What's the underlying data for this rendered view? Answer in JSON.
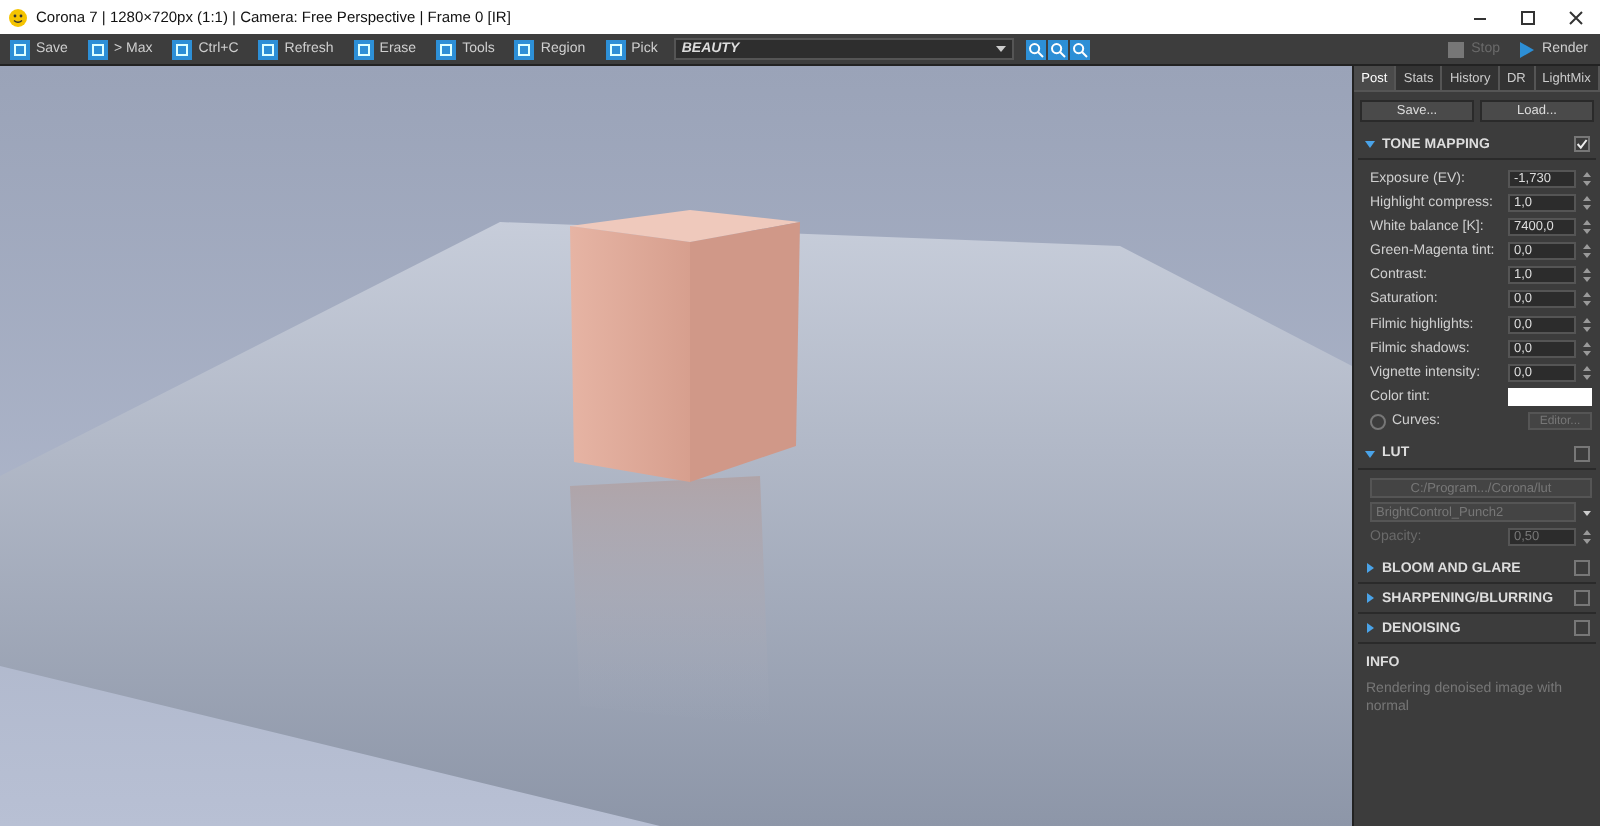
{
  "window": {
    "title": "Corona 7 | 1280×720px (1:1) | Camera: Free Perspective | Frame 0 [IR]"
  },
  "toolbar": {
    "buttons": [
      "Save",
      "> Max",
      "Ctrl+C",
      "Refresh",
      "Erase",
      "Tools",
      "Region",
      "Pick"
    ],
    "pass": "BEAUTY",
    "stop": {
      "label": "Stop",
      "disabled": true
    },
    "render": {
      "label": "Render",
      "disabled": false
    }
  },
  "panel": {
    "tabs": [
      {
        "label": "Post",
        "selected": true
      },
      {
        "label": "Stats",
        "selected": false
      },
      {
        "label": "History",
        "selected": false
      },
      {
        "label": "DR",
        "selected": false
      },
      {
        "label": "LightMix",
        "selected": false
      }
    ],
    "buttons": [
      "Save...",
      "Load..."
    ],
    "sections": [
      {
        "title": "TONE MAPPING",
        "expanded": true,
        "checked": true,
        "rows": [
          {
            "kind": "spinner",
            "label": "Exposure (EV):",
            "value": "-1,730",
            "disabled": false
          },
          {
            "kind": "spinner",
            "label": "Highlight compress:",
            "value": "1,0",
            "disabled": false
          },
          {
            "kind": "spinner",
            "label": "White balance [K]:",
            "value": "7400,0",
            "disabled": false
          },
          {
            "kind": "spinner",
            "label": "Green-Magenta tint:",
            "value": "0,0",
            "disabled": false
          },
          {
            "kind": "spinner",
            "label": "Contrast:",
            "value": "1,0",
            "disabled": false
          },
          {
            "kind": "spinner",
            "label": "Saturation:",
            "value": "0,0",
            "disabled": false
          },
          {
            "kind": "spinner",
            "label": "Filmic highlights:",
            "value": "0,0",
            "disabled": false
          },
          {
            "kind": "spinner",
            "label": "Filmic shadows:",
            "value": "0,0",
            "disabled": false
          },
          {
            "kind": "spinner",
            "label": "Vignette intensity:",
            "value": "0,0",
            "disabled": false
          },
          {
            "kind": "color",
            "label": "Color tint:",
            "color": "#ffffff"
          },
          {
            "kind": "check",
            "label": "Curves:",
            "checked": false,
            "button": "Editor...",
            "disabled": true
          }
        ]
      },
      {
        "title": "LUT",
        "expanded": true,
        "checked": false,
        "rows": [
          {
            "kind": "path",
            "value": "C:/Program.../Corona/lut",
            "disabled": true
          },
          {
            "kind": "select",
            "value": "BrightControl_Punch2",
            "disabled": true
          },
          {
            "kind": "spinner",
            "label": "Opacity:",
            "value": "0,50",
            "disabled": true
          }
        ]
      },
      {
        "title": "BLOOM AND GLARE",
        "expanded": false,
        "checked": false
      },
      {
        "title": "SHARPENING/BLURRING",
        "expanded": false,
        "checked": false
      },
      {
        "title": "DENOISING",
        "expanded": false,
        "checked": false
      }
    ],
    "info": {
      "title": "INFO",
      "text": "Rendering denoised image with normal"
    }
  }
}
